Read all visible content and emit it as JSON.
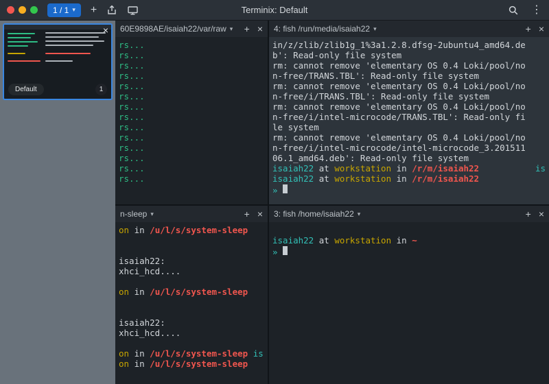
{
  "colors": {
    "fg": "#d2d6da",
    "green": "#2ebd85",
    "cyan": "#32c0b7",
    "yellow": "#c7a500",
    "red": "#f0564e",
    "accent": "#1b6acb"
  },
  "ui": {
    "caret": "▾",
    "add": "+",
    "close": "×",
    "kebab": "⋮",
    "plus": "+"
  },
  "titlebar": {
    "session_selector": "1 / 1",
    "title": "Terminix: Default"
  },
  "sidebar": {
    "session": {
      "label": "Default",
      "badge": "1",
      "close": "×"
    }
  },
  "panes": {
    "top_left": {
      "title": "60E9898AE/isaiah22/var/raw",
      "lines": [
        {
          "seg": [
            [
              "rs...",
              "green"
            ]
          ]
        },
        {
          "seg": [
            [
              "rs...",
              "green"
            ]
          ]
        },
        {
          "seg": [
            [
              "rs...",
              "green"
            ]
          ]
        },
        {
          "seg": [
            [
              "rs...",
              "green"
            ]
          ]
        },
        {
          "seg": [
            [
              "rs...",
              "green"
            ]
          ]
        },
        {
          "seg": [
            [
              "rs...",
              "green"
            ]
          ]
        },
        {
          "seg": [
            [
              "rs...",
              "green"
            ]
          ]
        },
        {
          "seg": [
            [
              "rs...",
              "green"
            ]
          ]
        },
        {
          "seg": [
            [
              "rs...",
              "green"
            ]
          ]
        },
        {
          "seg": [
            [
              "rs...",
              "green"
            ]
          ]
        },
        {
          "seg": [
            [
              "rs...",
              "green"
            ]
          ]
        },
        {
          "seg": [
            [
              "rs...",
              "green"
            ]
          ]
        },
        {
          "seg": [
            [
              "rs...",
              "green"
            ]
          ]
        },
        {
          "seg": [
            [
              "rs...",
              "green"
            ]
          ]
        }
      ]
    },
    "top_right": {
      "title": "4: fish /run/media/isaiah22",
      "lines": [
        {
          "seg": [
            [
              "in/z/zlib/zlib1g_1%3a1.2.8.dfsg-2ubuntu4_amd64.de",
              "fg"
            ]
          ]
        },
        {
          "seg": [
            [
              "b': Read-only file system",
              "fg"
            ]
          ]
        },
        {
          "seg": [
            [
              "rm: cannot remove 'elementary OS 0.4 Loki/pool/no",
              "fg"
            ]
          ]
        },
        {
          "seg": [
            [
              "n-free/TRANS.TBL': Read-only file system",
              "fg"
            ]
          ]
        },
        {
          "seg": [
            [
              "rm: cannot remove 'elementary OS 0.4 Loki/pool/no",
              "fg"
            ]
          ]
        },
        {
          "seg": [
            [
              "n-free/i/TRANS.TBL': Read-only file system",
              "fg"
            ]
          ]
        },
        {
          "seg": [
            [
              "rm: cannot remove 'elementary OS 0.4 Loki/pool/no",
              "fg"
            ]
          ]
        },
        {
          "seg": [
            [
              "n-free/i/intel-microcode/TRANS.TBL': Read-only fi",
              "fg"
            ]
          ]
        },
        {
          "seg": [
            [
              "le system",
              "fg"
            ]
          ]
        },
        {
          "seg": [
            [
              "rm: cannot remove 'elementary OS 0.4 Loki/pool/no",
              "fg"
            ]
          ]
        },
        {
          "seg": [
            [
              "n-free/i/intel-microcode/intel-microcode_3.201511",
              "fg"
            ]
          ]
        },
        {
          "seg": [
            [
              "06.1_amd64.deb': Read-only file system",
              "fg"
            ]
          ]
        },
        {
          "seg": [
            [
              "isaiah22",
              "cyan"
            ],
            [
              " at ",
              "fg"
            ],
            [
              "workstation",
              "yellow"
            ],
            [
              " in ",
              "fg"
            ],
            [
              "/r/m/isaiah22",
              "red",
              true
            ]
          ],
          "right": [
            [
              "is",
              "cyan"
            ]
          ]
        },
        {
          "seg": [
            [
              "isaiah22",
              "cyan"
            ],
            [
              " at ",
              "fg"
            ],
            [
              "workstation",
              "yellow"
            ],
            [
              " in ",
              "fg"
            ],
            [
              "/r/m/isaiah22",
              "red",
              true
            ]
          ]
        },
        {
          "seg": [
            [
              "» ",
              "cyan"
            ]
          ],
          "cursor": true
        }
      ]
    },
    "bottom_left": {
      "title": "n-sleep",
      "lines": [
        {
          "seg": [
            [
              "on",
              "yellow"
            ],
            [
              " in ",
              "fg"
            ],
            [
              "/u/l/s/system-sleep",
              "red",
              true
            ]
          ]
        },
        {
          "seg": []
        },
        {
          "seg": []
        },
        {
          "seg": [
            [
              "isaiah22:",
              "fg"
            ]
          ]
        },
        {
          "seg": [
            [
              "xhci_hcd....",
              "fg"
            ]
          ]
        },
        {
          "seg": []
        },
        {
          "seg": [
            [
              "on",
              "yellow"
            ],
            [
              " in ",
              "fg"
            ],
            [
              "/u/l/s/system-sleep",
              "red",
              true
            ]
          ]
        },
        {
          "seg": []
        },
        {
          "seg": []
        },
        {
          "seg": [
            [
              "isaiah22:",
              "fg"
            ]
          ]
        },
        {
          "seg": [
            [
              "xhci_hcd....",
              "fg"
            ]
          ]
        },
        {
          "seg": []
        },
        {
          "seg": [
            [
              "on",
              "yellow"
            ],
            [
              " in ",
              "fg"
            ],
            [
              "/u/l/s/system-sleep",
              "red",
              true
            ],
            [
              " is",
              "cyan"
            ]
          ]
        },
        {
          "seg": [
            [
              "on",
              "yellow"
            ],
            [
              " in ",
              "fg"
            ],
            [
              "/u/l/s/system-sleep",
              "red",
              true
            ]
          ]
        }
      ]
    },
    "bottom_right": {
      "title": "3: fish /home/isaiah22",
      "lines": [
        {
          "seg": []
        },
        {
          "seg": [
            [
              "isaiah22",
              "cyan"
            ],
            [
              " at ",
              "fg"
            ],
            [
              "workstation",
              "yellow"
            ],
            [
              " in ",
              "fg"
            ],
            [
              "~",
              "red",
              true
            ]
          ]
        },
        {
          "seg": [
            [
              "» ",
              "cyan"
            ]
          ],
          "cursor": true
        }
      ]
    }
  }
}
